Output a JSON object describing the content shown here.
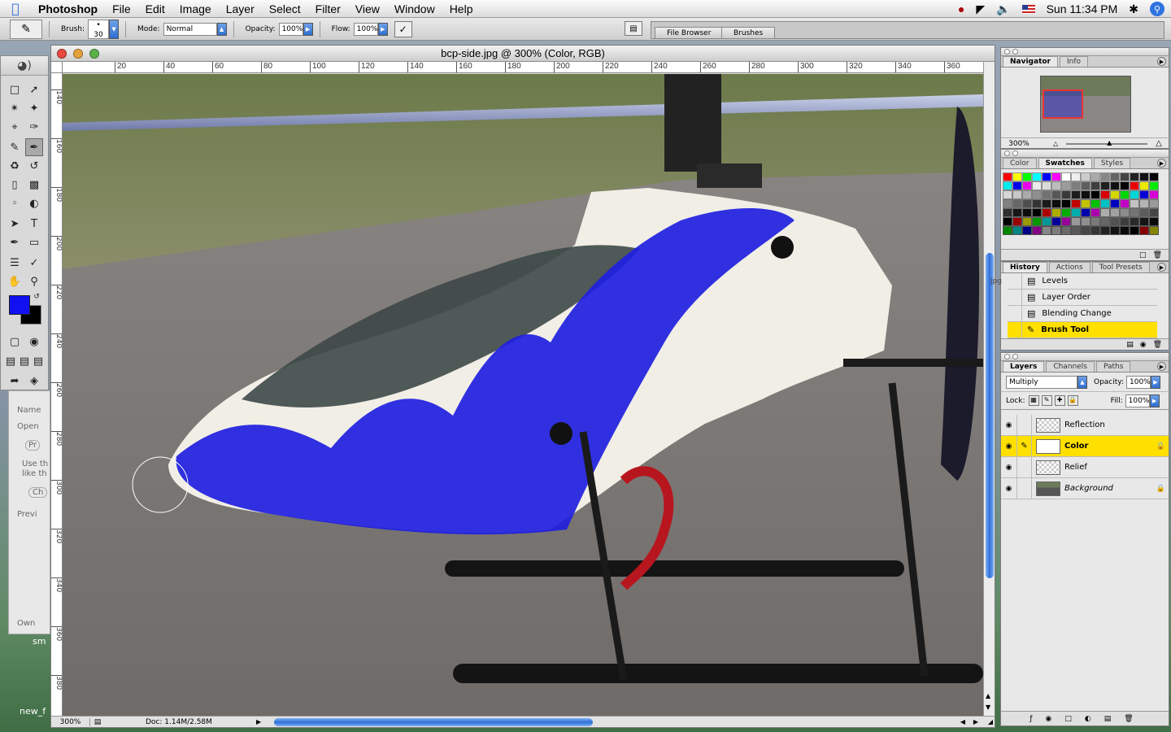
{
  "menubar": {
    "app_name": "Photoshop",
    "menus": [
      "File",
      "Edit",
      "Image",
      "Layer",
      "Select",
      "Filter",
      "View",
      "Window",
      "Help"
    ],
    "clock": "Sun 11:34 PM"
  },
  "options": {
    "brush_label": "Brush:",
    "brush_size": "30",
    "mode_label": "Mode:",
    "mode_value": "Normal",
    "opacity_label": "Opacity:",
    "opacity_value": "100%",
    "flow_label": "Flow:",
    "flow_value": "100%",
    "well_tabs": [
      "File Browser",
      "Brushes"
    ]
  },
  "document": {
    "title": "bcp-side.jpg @ 300% (Color, RGB)",
    "ruler_top": [
      "20",
      "40",
      "60",
      "80",
      "100",
      "120",
      "140",
      "160",
      "180",
      "200",
      "220",
      "240",
      "260",
      "280",
      "300",
      "320",
      "340",
      "360"
    ],
    "ruler_left": [
      "140",
      "160",
      "180",
      "200",
      "220",
      "240",
      "260",
      "280",
      "300",
      "320",
      "340",
      "360",
      "380"
    ],
    "zoom": "300%",
    "doc_size": "Doc: 1.14M/2.58M"
  },
  "left_window": {
    "items": [
      "Name",
      "Open",
      "Pr",
      "Use th",
      "like th",
      "Ch",
      "Previ",
      "Own",
      "sm",
      "new_f"
    ]
  },
  "navigator": {
    "tabs": [
      "Navigator",
      "Info"
    ],
    "zoom": "300%"
  },
  "color_palette": {
    "tabs": [
      "Color",
      "Swatches",
      "Styles"
    ],
    "swatches": [
      "#ff0000",
      "#ffff00",
      "#00ff00",
      "#00ffff",
      "#0000ff",
      "#ff00ff",
      "#ffffff",
      "#eeeeee",
      "#cccccc",
      "#aaaaaa",
      "#888888",
      "#666666",
      "#444444",
      "#222222",
      "#111111",
      "#000000"
    ]
  },
  "history": {
    "tabs": [
      "History",
      "Actions",
      "Tool Presets"
    ],
    "items": [
      "Levels",
      "Layer Order",
      "Blending Change",
      "Brush Tool"
    ],
    "side_fragment": "jpg"
  },
  "layers": {
    "tabs": [
      "Layers",
      "Channels",
      "Paths"
    ],
    "blend_mode": "Multiply",
    "opacity_label": "Opacity:",
    "opacity": "100%",
    "lock_label": "Lock:",
    "fill_label": "Fill:",
    "fill": "100%",
    "items": [
      {
        "name": "Reflection"
      },
      {
        "name": "Color"
      },
      {
        "name": "Relief"
      },
      {
        "name": "Background"
      }
    ]
  },
  "colors": {
    "foreground": "#1010f0",
    "background": "#000000",
    "highlight": "#ffe000",
    "accent": "#2f6fd8"
  }
}
